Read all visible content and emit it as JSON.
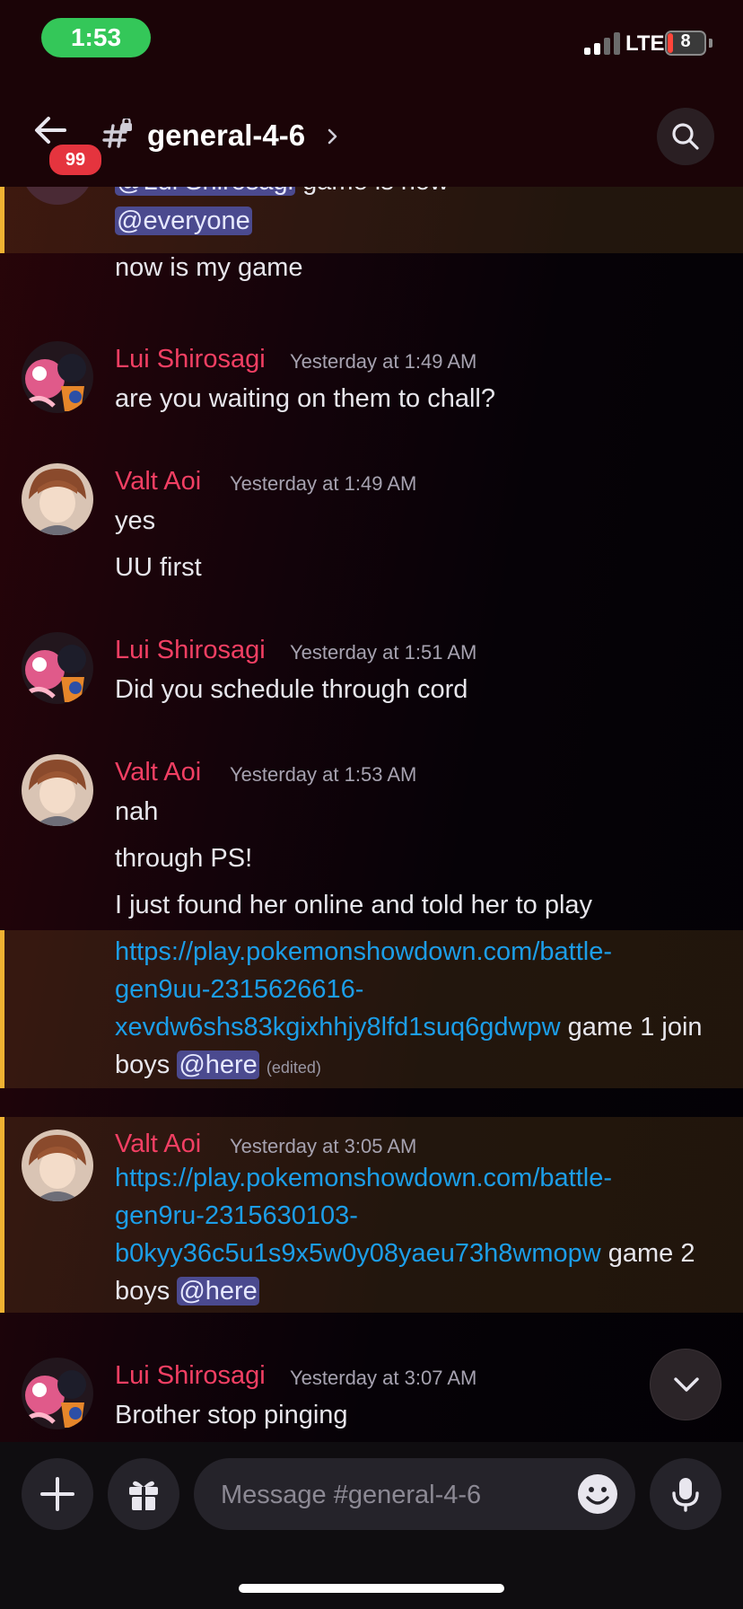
{
  "status_bar": {
    "time": "1:53",
    "network": "LTE",
    "battery_level": "8",
    "battery_color": "#ff453a",
    "signal_bars_active": 2
  },
  "header": {
    "back_icon": "arrow-left-icon",
    "unread_badge": "99",
    "channel_icon": "hash-lock-icon",
    "channel_name": "general-4-6",
    "chevron_icon": "chevron-right-icon",
    "search_icon": "search-icon"
  },
  "messages": [
    {
      "partial_top_line": {
        "mention": "@Lui Shirosagi",
        "text": " game is now"
      },
      "lines": [
        {
          "mention": "@everyone"
        },
        {
          "text": "now is my game"
        }
      ]
    },
    {
      "author": "Lui Shirosagi",
      "timestamp": "Yesterday at 1:49 AM",
      "lines": [
        "are you waiting on them to chall?"
      ]
    },
    {
      "author": "Valt Aoi",
      "timestamp": "Yesterday at 1:49 AM",
      "lines": [
        "yes",
        "UU first"
      ]
    },
    {
      "author": "Lui Shirosagi",
      "timestamp": "Yesterday at 1:51 AM",
      "lines": [
        "Did you schedule through cord"
      ]
    },
    {
      "author": "Valt Aoi",
      "timestamp": "Yesterday at 1:53 AM",
      "lines": [
        "nah",
        "through PS!",
        "I just found her online and told her to play"
      ],
      "highlighted": {
        "link_line1": "https://play.pokemonshowdown.com/battle-",
        "link_line2": "gen9uu-2315626616-",
        "link_line3": "xevdw6shs83kgixhhjy8lfd1suq6gdwpw",
        "text_after_link": " game 1 join",
        "text_before_mention": "boys ",
        "mention": "@here",
        "edited": "(edited)"
      }
    },
    {
      "author": "Valt Aoi",
      "timestamp": "Yesterday at 3:05 AM",
      "highlighted": {
        "link_line1": "https://play.pokemonshowdown.com/battle-",
        "link_line2": "gen9ru-2315630103-",
        "link_line3": "b0kyy36c5u1s9x5w0y08yaeu73h8wmopw",
        "text_after_link": " game 2",
        "text_before_mention": "boys ",
        "mention": "@here"
      }
    },
    {
      "author": "Lui Shirosagi",
      "timestamp": "Yesterday at 3:07 AM",
      "lines": [
        "Brother stop pinging"
      ]
    }
  ],
  "jump_button": {
    "icon": "chevron-down-icon"
  },
  "composer": {
    "add_icon": "plus-icon",
    "gift_icon": "gift-icon",
    "placeholder": "Message #general-4-6",
    "emoji_icon": "emoji-icon",
    "mic_icon": "microphone-icon"
  },
  "colors": {
    "author": "#f23f63",
    "link": "#1c9ee8",
    "mention_bg": "#4b4a8f",
    "highlight_border": "#f0b232"
  }
}
